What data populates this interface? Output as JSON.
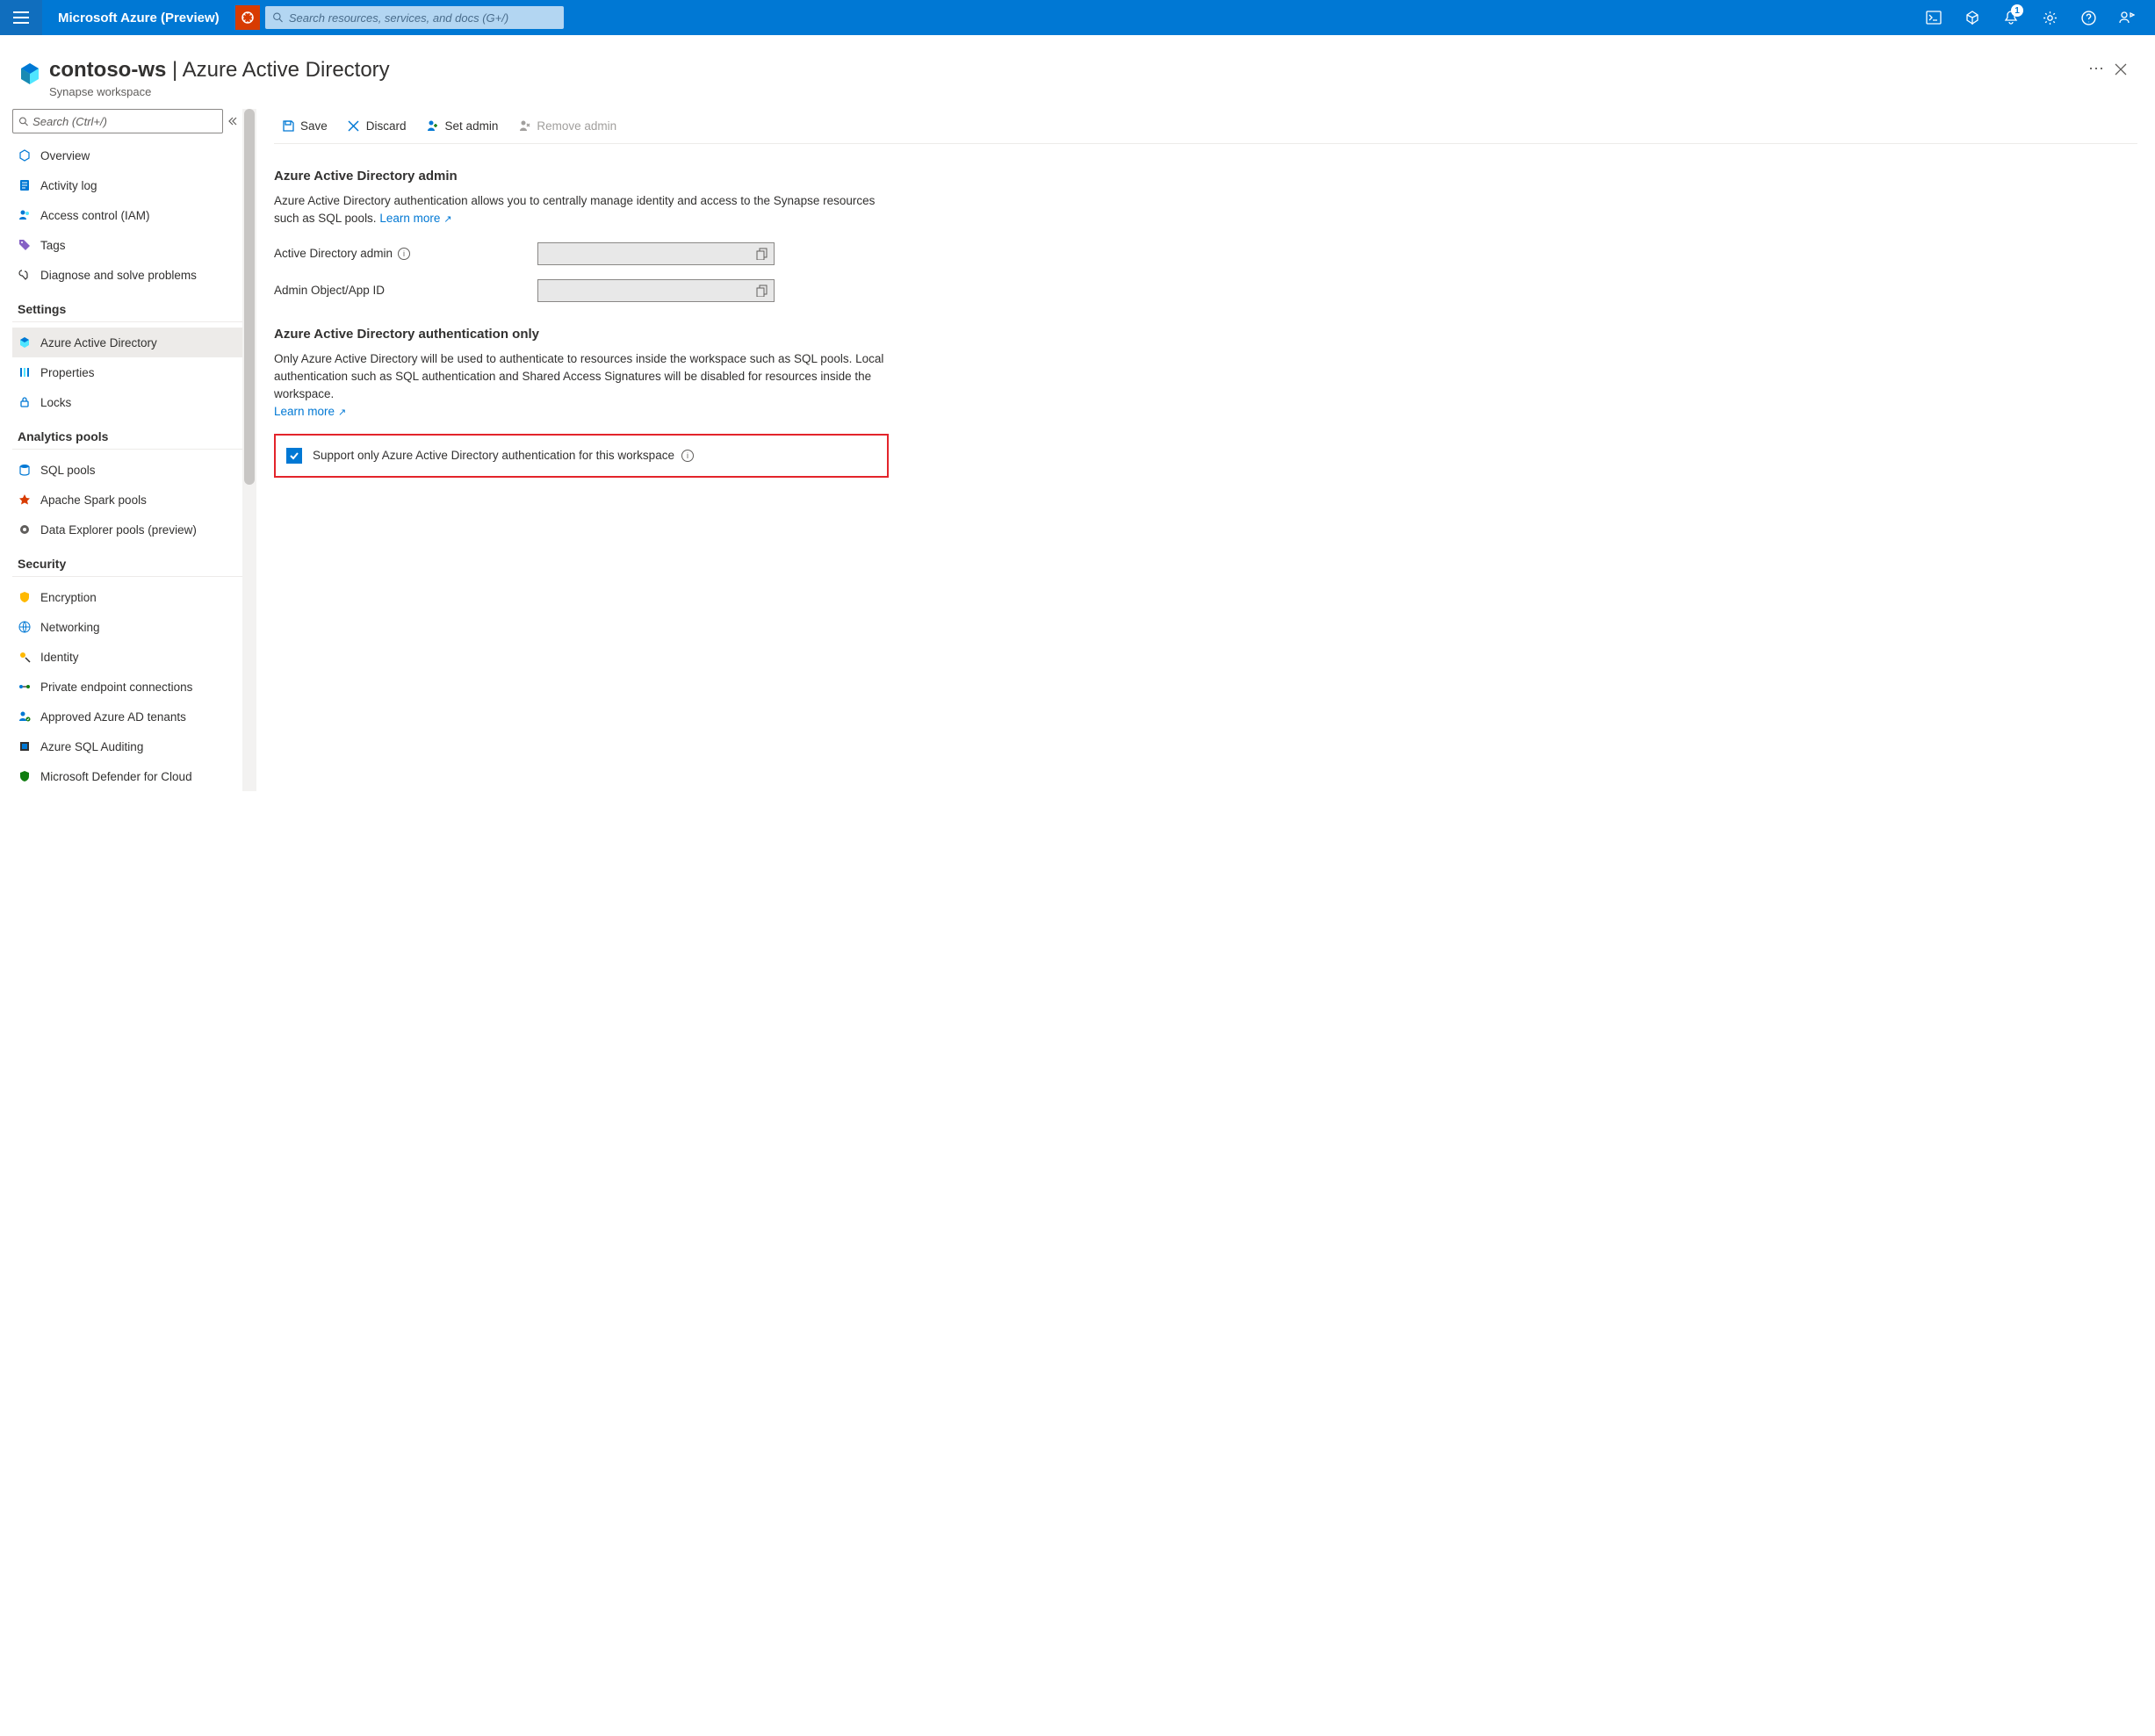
{
  "header": {
    "brand": "Microsoft Azure (Preview)",
    "search_placeholder": "Search resources, services, and docs (G+/)",
    "notification_count": "1"
  },
  "page": {
    "resource_name": "contoso-ws",
    "blade_title": "Azure Active Directory",
    "resource_type": "Synapse workspace"
  },
  "sidebar": {
    "search_placeholder": "Search (Ctrl+/)",
    "top_items": [
      {
        "label": "Overview"
      },
      {
        "label": "Activity log"
      },
      {
        "label": "Access control (IAM)"
      },
      {
        "label": "Tags"
      },
      {
        "label": "Diagnose and solve problems"
      }
    ],
    "sections": [
      {
        "title": "Settings",
        "items": [
          {
            "label": "Azure Active Directory",
            "active": true
          },
          {
            "label": "Properties"
          },
          {
            "label": "Locks"
          }
        ]
      },
      {
        "title": "Analytics pools",
        "items": [
          {
            "label": "SQL pools"
          },
          {
            "label": "Apache Spark pools"
          },
          {
            "label": "Data Explorer pools (preview)"
          }
        ]
      },
      {
        "title": "Security",
        "items": [
          {
            "label": "Encryption"
          },
          {
            "label": "Networking"
          },
          {
            "label": "Identity"
          },
          {
            "label": "Private endpoint connections"
          },
          {
            "label": "Approved Azure AD tenants"
          },
          {
            "label": "Azure SQL Auditing"
          },
          {
            "label": "Microsoft Defender for Cloud"
          }
        ]
      }
    ]
  },
  "toolbar": {
    "save": "Save",
    "discard": "Discard",
    "set_admin": "Set admin",
    "remove_admin": "Remove admin"
  },
  "content": {
    "admin_title": "Azure Active Directory admin",
    "admin_desc": "Azure Active Directory authentication allows you to centrally manage identity and access to the Synapse resources such as SQL pools.",
    "learn_more": "Learn more",
    "field_ad_admin": "Active Directory admin",
    "field_admin_id": "Admin Object/App ID",
    "auth_only_title": "Azure Active Directory authentication only",
    "auth_only_desc": "Only Azure Active Directory will be used to authenticate to resources inside the workspace such as SQL pools. Local authentication such as SQL authentication and Shared Access Signatures will be disabled for resources inside the workspace.",
    "checkbox_label": "Support only Azure Active Directory authentication for this workspace"
  }
}
